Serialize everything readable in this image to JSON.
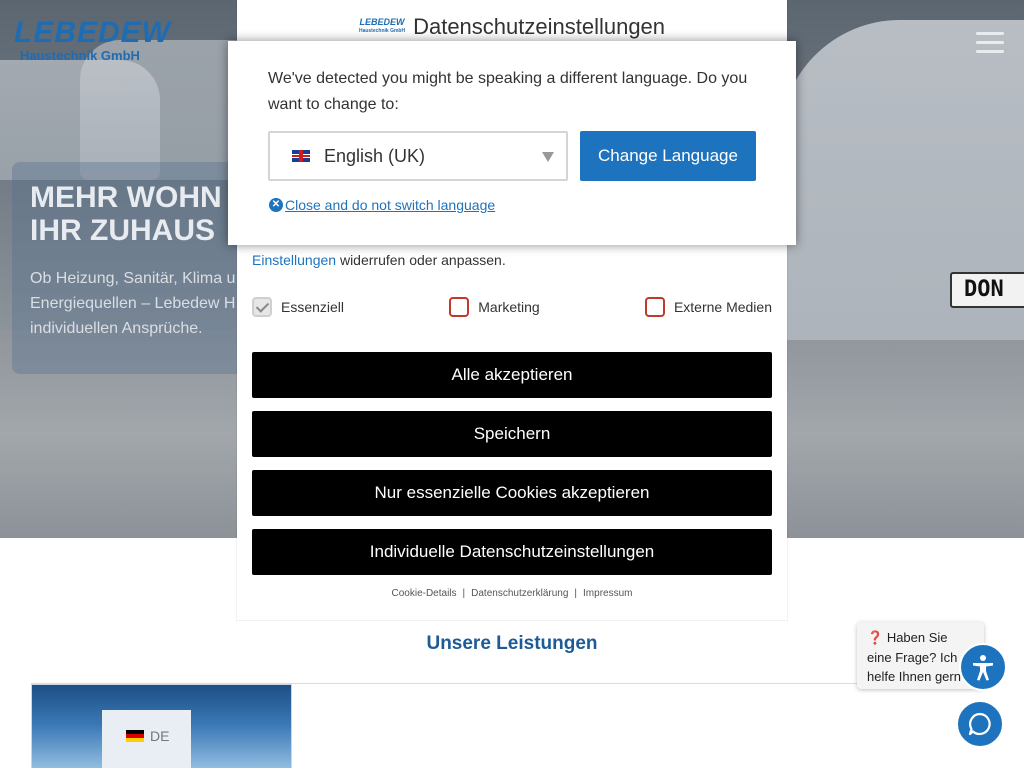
{
  "site": {
    "logo_brand": "LEBEDEW",
    "logo_sub": "Haustechnik GmbH"
  },
  "hero": {
    "title_line1": "MEHR WOHN",
    "title_line2": "IHR ZUHAUS",
    "text_line1": "Ob Heizung, Sanitär, Klima u",
    "text_line2": "Energiequellen – Lebedew H",
    "text_line3": "individuellen Ansprüche.",
    "plate_text": "DON"
  },
  "services": {
    "title": "Unsere Leistungen"
  },
  "language_tab": {
    "code": "DE"
  },
  "chat": {
    "bubble_prefix": "❓",
    "bubble_text": "Haben Sie eine Frage? Ich helfe Ihnen gern weite"
  },
  "privacy": {
    "title": "Datenschutzeinstellungen",
    "mini_logo": "LEBEDEW",
    "mini_logo_sub": "Haustechnik GmbH",
    "text_link": "Einstellungen",
    "text_rest": " widerrufen oder anpassen.",
    "checkboxes": [
      {
        "label": "Essenziell",
        "checked": true
      },
      {
        "label": "Marketing",
        "checked": false
      },
      {
        "label": "Externe Medien",
        "checked": false
      }
    ],
    "buttons": {
      "accept_all": "Alle akzeptieren",
      "save": "Speichern",
      "essential_only": "Nur essenzielle Cookies akzeptieren",
      "individual": "Individuelle Datenschutzeinstellungen"
    },
    "footer_links": [
      "Cookie-Details",
      "Datenschutzerklärung",
      "Impressum"
    ],
    "footer_sep": "|"
  },
  "language_modal": {
    "message": "We've detected you might be speaking a different language. Do you want to change to:",
    "selected_language": "English (UK)",
    "change_button": "Change Language",
    "close_link": "Close and do not switch language",
    "close_icon_glyph": "✕"
  },
  "colors": {
    "accent": "#1e73be",
    "privacy_button": "#000000",
    "section_title": "#1e5a96"
  }
}
